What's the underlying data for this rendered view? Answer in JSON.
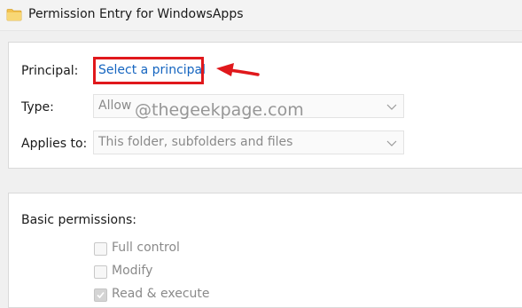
{
  "window": {
    "title": "Permission Entry for WindowsApps",
    "icon": "folder-icon"
  },
  "principal": {
    "label": "Principal:",
    "link_text": "Select a principal"
  },
  "type": {
    "label": "Type:",
    "value": "Allow"
  },
  "applies_to": {
    "label": "Applies to:",
    "value": "This folder, subfolders and files"
  },
  "watermark": "@thegeekpage.com",
  "basic_permissions": {
    "heading": "Basic permissions:",
    "items": [
      {
        "label": "Full control",
        "checked": false
      },
      {
        "label": "Modify",
        "checked": false
      },
      {
        "label": "Read & execute",
        "checked": true
      }
    ]
  },
  "colors": {
    "annotation_red": "#e0181c",
    "link_blue": "#1565c0"
  }
}
